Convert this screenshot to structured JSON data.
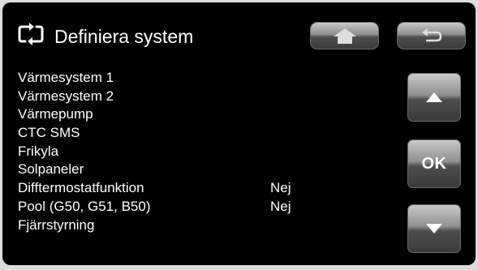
{
  "header": {
    "title": "Definiera system",
    "title_icon": "refresh-arrows-icon",
    "home_icon": "home-icon",
    "back_icon": "return-arrow-icon"
  },
  "menu": {
    "items": [
      {
        "label": "Värmesystem 1",
        "value": ""
      },
      {
        "label": "Värmesystem 2",
        "value": ""
      },
      {
        "label": "Värmepump",
        "value": ""
      },
      {
        "label": "CTC SMS",
        "value": ""
      },
      {
        "label": "Frikyla",
        "value": ""
      },
      {
        "label": "Solpaneler",
        "value": ""
      },
      {
        "label": "Difftermostatfunktion",
        "value": "Nej"
      },
      {
        "label": "Pool (G50, G51, B50)",
        "value": "Nej"
      },
      {
        "label": "Fjärrstyrning",
        "value": ""
      }
    ]
  },
  "controls": {
    "up_icon": "triangle-up-icon",
    "ok_label": "OK",
    "down_icon": "triangle-down-icon"
  },
  "colors": {
    "background": "#000000",
    "text": "#ffffff",
    "button": "#8f8f8f"
  }
}
